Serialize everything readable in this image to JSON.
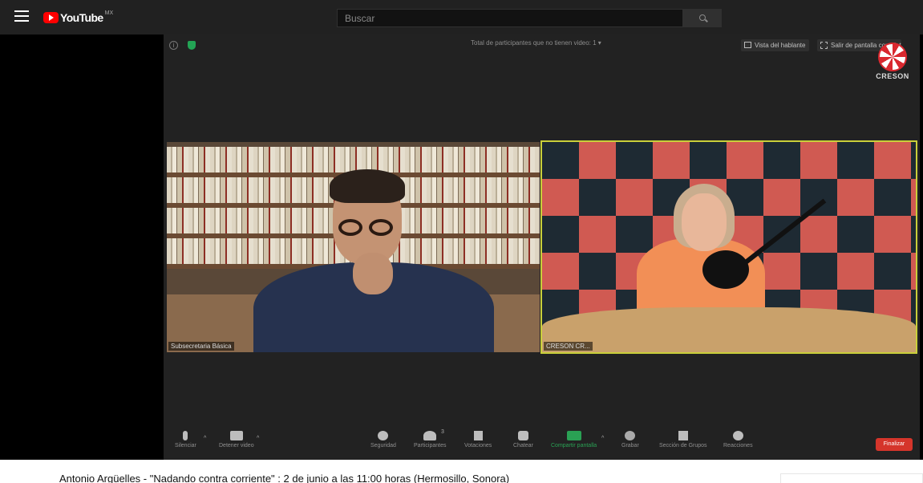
{
  "header": {
    "logo_text": "YouTube",
    "country_code": "MX",
    "search_placeholder": "Buscar"
  },
  "zoom": {
    "participants_note": "Total de participantes que no tienen video: 1",
    "dropdown_caret": "▾",
    "speaker_view_label": "Vista del hablante",
    "exit_fullscreen_label": "Salir de pantalla completa",
    "logo_text": "CRESON",
    "tiles": [
      {
        "label": "Subsecretaria Básica"
      },
      {
        "label": "CRESON CR..."
      }
    ],
    "controls": {
      "mute": "Silenciar",
      "stop_video": "Detener video",
      "security": "Seguridad",
      "participants": "Participantes",
      "participants_count": "3",
      "polls": "Votaciones",
      "chat": "Chatear",
      "share_screen": "Compartir pantalla",
      "record": "Grabar",
      "breakout_rooms": "Sección de Grupos",
      "reactions": "Reacciones",
      "end": "Finalizar",
      "caret": "^"
    },
    "colors": {
      "active_speaker_border": "#c9cf3a",
      "share_green": "#2aa154",
      "end_red": "#d5352b"
    }
  },
  "video": {
    "title": "Antonio Argüelles - \"Nadando contra corriente\" : 2 de junio a las 11:00 horas (Hermosillo, Sonora)"
  },
  "colors": {
    "youtube_red": "#ff0000",
    "header_bg": "#212121"
  }
}
